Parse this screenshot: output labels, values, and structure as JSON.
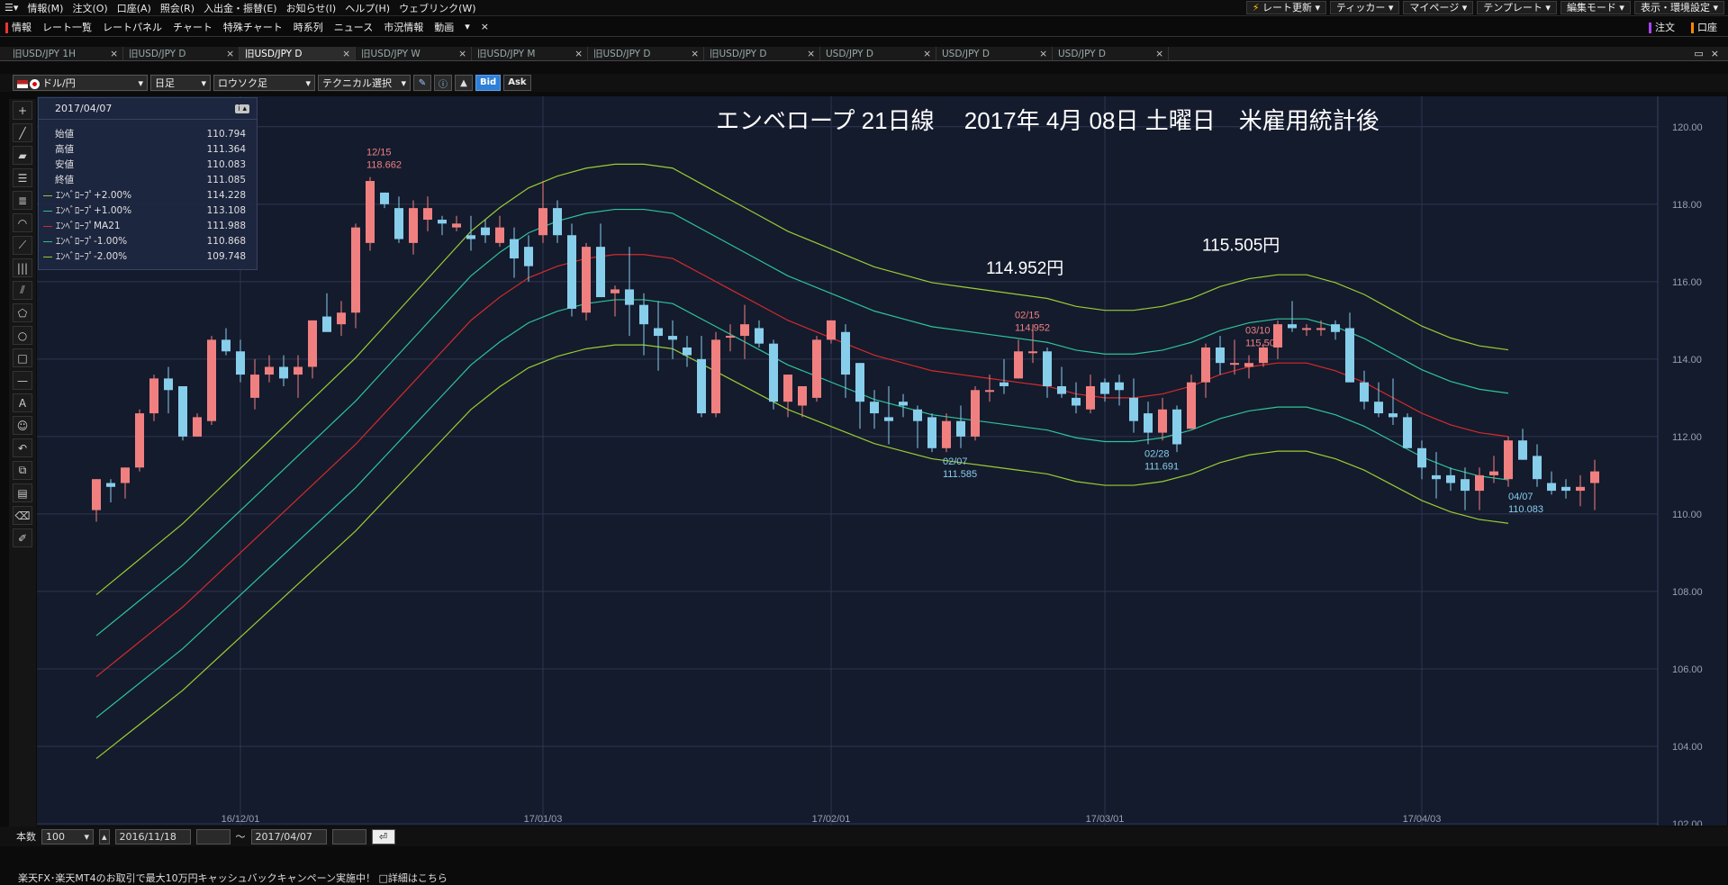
{
  "menu": {
    "items": [
      "情報(M)",
      "注文(O)",
      "口座(A)",
      "照会(R)",
      "入出金・振替(E)",
      "お知らせ(I)",
      "ヘルプ(H)",
      "ウェブリンク(W)"
    ],
    "right_buttons": [
      "レート更新",
      "ティッカー",
      "マイページ",
      "テンプレート",
      "編集モード",
      "表示・環境設定"
    ]
  },
  "nav": {
    "items": [
      "情報",
      "レート一覧",
      "レートパネル",
      "チャート",
      "特殊チャート",
      "時系列",
      "ニュース",
      "市況情報",
      "動画"
    ],
    "right": [
      "注文",
      "口座"
    ]
  },
  "tabs": [
    {
      "label": "旧USD/JPY 1H",
      "active": false
    },
    {
      "label": "旧USD/JPY D",
      "active": false
    },
    {
      "label": "旧USD/JPY D",
      "active": true
    },
    {
      "label": "旧USD/JPY W",
      "active": false
    },
    {
      "label": "旧USD/JPY M",
      "active": false
    },
    {
      "label": "旧USD/JPY D",
      "active": false
    },
    {
      "label": "旧USD/JPY D",
      "active": false
    },
    {
      "label": "USD/JPY D",
      "active": false
    },
    {
      "label": "USD/JPY D",
      "active": false
    },
    {
      "label": "USD/JPY D",
      "active": false
    }
  ],
  "toolbar": {
    "pair": "ドル/円",
    "period": "日足",
    "chart_type": "ロウソク足",
    "technical": "テクニカル選択",
    "bid": "Bid",
    "ask": "Ask"
  },
  "info": {
    "date": "2017/04/07",
    "rows": [
      {
        "label": "始値",
        "value": "110.794"
      },
      {
        "label": "高値",
        "value": "111.364"
      },
      {
        "label": "安値",
        "value": "110.083"
      },
      {
        "label": "終値",
        "value": "111.085"
      }
    ],
    "indicators": [
      {
        "label": "ｴﾝﾍﾞﾛｰﾌﾟ+2.00%",
        "value": "114.228",
        "color": "#9acd32"
      },
      {
        "label": "ｴﾝﾍﾞﾛｰﾌﾟ+1.00%",
        "value": "113.108",
        "color": "#2ec49a"
      },
      {
        "label": "ｴﾝﾍﾞﾛｰﾌﾟMA21",
        "value": "111.988",
        "color": "#d42b2b"
      },
      {
        "label": "ｴﾝﾍﾞﾛｰﾌﾟ-1.00%",
        "value": "110.868",
        "color": "#2ec49a"
      },
      {
        "label": "ｴﾝﾍﾞﾛｰﾌﾟ-2.00%",
        "value": "109.748",
        "color": "#9acd32"
      }
    ]
  },
  "bottom": {
    "count_label": "本数",
    "count": "100",
    "from": "2016/11/18",
    "tilde": "～",
    "to": "2017/04/07"
  },
  "status": "楽天FX･楽天MT4のお取引で最大10万円キャッシュバックキャンペーン実施中！ □詳細はこちら",
  "chart_data": {
    "type": "candlestick",
    "title": "エンベロープ 21日線　 2017年 4月 08日 土曜日　米雇用統計後",
    "ylim": [
      102,
      120.6
    ],
    "yticks": [
      "102.00",
      "104.00",
      "106.00",
      "108.00",
      "110.00",
      "112.00",
      "114.00",
      "116.00",
      "118.00",
      "120.00"
    ],
    "xticks": [
      {
        "i": 10,
        "label": "16/12/01"
      },
      {
        "i": 31,
        "label": "17/01/03"
      },
      {
        "i": 51,
        "label": "17/02/01"
      },
      {
        "i": 70,
        "label": "17/03/01"
      },
      {
        "i": 92,
        "label": "17/04/03"
      }
    ],
    "colors": {
      "up": "#f08080",
      "down": "#87ceeb"
    },
    "candles": [
      [
        110.1,
        110.9,
        109.8,
        110.9
      ],
      [
        110.8,
        110.9,
        110.3,
        110.7
      ],
      [
        110.8,
        111.2,
        110.4,
        111.2
      ],
      [
        111.2,
        112.7,
        111.1,
        112.6
      ],
      [
        112.6,
        113.6,
        112.4,
        113.5
      ],
      [
        113.5,
        113.8,
        112.6,
        113.2
      ],
      [
        113.3,
        113.0,
        111.9,
        112.0
      ],
      [
        112.0,
        112.6,
        112.0,
        112.5
      ],
      [
        112.4,
        114.6,
        112.3,
        114.5
      ],
      [
        114.5,
        114.8,
        114.1,
        114.2
      ],
      [
        114.2,
        114.5,
        113.4,
        113.6
      ],
      [
        113.0,
        114.0,
        112.7,
        113.6
      ],
      [
        113.6,
        114.1,
        113.4,
        113.8
      ],
      [
        113.8,
        114.1,
        113.3,
        113.5
      ],
      [
        113.6,
        114.1,
        113.0,
        113.8
      ],
      [
        113.8,
        114.8,
        113.5,
        115.0
      ],
      [
        115.1,
        115.7,
        114.8,
        114.7
      ],
      [
        114.9,
        115.5,
        114.6,
        115.2
      ],
      [
        115.2,
        117.5,
        114.8,
        117.4
      ],
      [
        117.0,
        118.7,
        116.8,
        118.6
      ],
      [
        118.3,
        118.3,
        117.9,
        118.0
      ],
      [
        117.9,
        118.2,
        117.0,
        117.1
      ],
      [
        117.0,
        118.1,
        116.7,
        117.9
      ],
      [
        117.6,
        118.2,
        117.3,
        117.9
      ],
      [
        117.6,
        117.7,
        117.2,
        117.5
      ],
      [
        117.4,
        117.7,
        117.3,
        117.5
      ],
      [
        117.2,
        117.7,
        116.8,
        117.1
      ],
      [
        117.4,
        117.6,
        117.0,
        117.2
      ],
      [
        117.0,
        117.7,
        116.9,
        117.4
      ],
      [
        117.1,
        117.4,
        116.1,
        116.6
      ],
      [
        116.9,
        117.2,
        116.0,
        116.4
      ],
      [
        117.2,
        118.6,
        117.0,
        117.9
      ],
      [
        117.9,
        118.1,
        117.0,
        117.2
      ],
      [
        117.2,
        117.5,
        115.1,
        115.3
      ],
      [
        115.2,
        117.0,
        115.0,
        116.9
      ],
      [
        116.9,
        117.5,
        115.6,
        115.6
      ],
      [
        115.7,
        115.9,
        115.1,
        115.8
      ],
      [
        115.8,
        116.9,
        114.6,
        115.4
      ],
      [
        115.4,
        115.7,
        114.1,
        114.9
      ],
      [
        114.8,
        115.5,
        113.7,
        114.6
      ],
      [
        114.6,
        115.0,
        114.0,
        114.5
      ],
      [
        114.3,
        114.6,
        113.8,
        114.1
      ],
      [
        114.0,
        114.6,
        112.5,
        112.6
      ],
      [
        112.6,
        114.7,
        112.5,
        114.5
      ],
      [
        114.6,
        114.9,
        114.2,
        114.6
      ],
      [
        114.6,
        115.4,
        114.0,
        114.9
      ],
      [
        114.8,
        115.0,
        114.3,
        114.4
      ],
      [
        114.4,
        114.5,
        112.7,
        112.9
      ],
      [
        112.9,
        113.6,
        112.5,
        113.6
      ],
      [
        112.8,
        113.3,
        112.5,
        113.3
      ],
      [
        113.0,
        114.6,
        112.9,
        114.5
      ],
      [
        114.5,
        115.0,
        114.4,
        115.0
      ],
      [
        114.7,
        114.9,
        113.0,
        113.6
      ],
      [
        113.9,
        113.9,
        112.2,
        112.9
      ],
      [
        112.9,
        113.2,
        112.2,
        112.6
      ],
      [
        112.5,
        113.3,
        111.8,
        112.4
      ],
      [
        112.9,
        113.1,
        112.5,
        112.8
      ],
      [
        112.7,
        112.8,
        111.7,
        112.4
      ],
      [
        112.5,
        112.6,
        111.6,
        111.7
      ],
      [
        111.7,
        112.6,
        111.6,
        112.4
      ],
      [
        112.4,
        112.8,
        111.7,
        112.0
      ],
      [
        112.0,
        113.3,
        111.9,
        113.2
      ],
      [
        113.2,
        113.6,
        112.9,
        113.2
      ],
      [
        113.4,
        114.0,
        113.1,
        113.3
      ],
      [
        113.5,
        114.5,
        113.5,
        114.2
      ],
      [
        114.2,
        114.9,
        113.9,
        114.2
      ],
      [
        114.2,
        114.3,
        113.0,
        113.3
      ],
      [
        113.3,
        113.8,
        113.0,
        113.1
      ],
      [
        113.0,
        113.4,
        112.6,
        112.8
      ],
      [
        112.7,
        113.6,
        112.6,
        113.3
      ],
      [
        113.4,
        113.5,
        112.9,
        113.1
      ],
      [
        113.4,
        113.6,
        112.8,
        113.2
      ],
      [
        113.0,
        113.5,
        112.1,
        112.4
      ],
      [
        112.6,
        112.9,
        111.8,
        112.1
      ],
      [
        112.1,
        113.0,
        111.9,
        112.7
      ],
      [
        112.7,
        112.8,
        111.6,
        111.8
      ],
      [
        112.2,
        113.6,
        112.2,
        113.4
      ],
      [
        113.4,
        114.4,
        113.0,
        114.3
      ],
      [
        114.3,
        114.6,
        113.6,
        113.9
      ],
      [
        113.9,
        114.5,
        113.6,
        113.9
      ],
      [
        113.8,
        114.1,
        113.5,
        113.9
      ],
      [
        113.9,
        114.4,
        113.8,
        114.3
      ],
      [
        114.3,
        115.0,
        114.0,
        114.9
      ],
      [
        114.9,
        115.5,
        114.7,
        114.8
      ],
      [
        114.8,
        114.9,
        114.6,
        114.8
      ],
      [
        114.8,
        115.0,
        114.6,
        114.8
      ],
      [
        114.9,
        115.0,
        114.5,
        114.7
      ],
      [
        114.8,
        115.2,
        113.4,
        113.4
      ],
      [
        113.4,
        113.7,
        112.7,
        112.9
      ],
      [
        112.9,
        113.4,
        112.5,
        112.6
      ],
      [
        112.6,
        113.5,
        112.3,
        112.5
      ],
      [
        112.5,
        112.6,
        111.7,
        111.7
      ],
      [
        111.7,
        111.9,
        110.9,
        111.2
      ],
      [
        111.0,
        111.6,
        110.4,
        110.9
      ],
      [
        111.0,
        111.2,
        110.6,
        110.8
      ],
      [
        110.9,
        111.2,
        110.1,
        110.6
      ],
      [
        110.6,
        111.2,
        110.1,
        111.0
      ],
      [
        111.0,
        111.5,
        110.8,
        111.1
      ],
      [
        110.9,
        112.0,
        110.7,
        111.9
      ],
      [
        111.9,
        112.2,
        111.4,
        111.4
      ],
      [
        111.5,
        111.8,
        110.7,
        110.9
      ],
      [
        110.8,
        111.1,
        110.5,
        110.6
      ],
      [
        110.7,
        110.9,
        110.4,
        110.6
      ],
      [
        110.6,
        111.0,
        110.2,
        110.7
      ],
      [
        110.8,
        111.4,
        110.1,
        111.1
      ]
    ],
    "envelope": {
      "ma21": [
        [
          0,
          105.8
        ],
        [
          2,
          106.4
        ],
        [
          4,
          107.0
        ],
        [
          6,
          107.6
        ],
        [
          8,
          108.3
        ],
        [
          10,
          109.0
        ],
        [
          12,
          109.7
        ],
        [
          14,
          110.4
        ],
        [
          16,
          111.1
        ],
        [
          18,
          111.8
        ],
        [
          20,
          112.6
        ],
        [
          22,
          113.4
        ],
        [
          24,
          114.2
        ],
        [
          26,
          115.0
        ],
        [
          28,
          115.6
        ],
        [
          30,
          116.1
        ],
        [
          32,
          116.4
        ],
        [
          34,
          116.6
        ],
        [
          36,
          116.7
        ],
        [
          38,
          116.7
        ],
        [
          40,
          116.6
        ],
        [
          42,
          116.2
        ],
        [
          44,
          115.8
        ],
        [
          46,
          115.4
        ],
        [
          48,
          115.0
        ],
        [
          50,
          114.7
        ],
        [
          52,
          114.4
        ],
        [
          54,
          114.1
        ],
        [
          56,
          113.9
        ],
        [
          58,
          113.7
        ],
        [
          60,
          113.6
        ],
        [
          62,
          113.5
        ],
        [
          64,
          113.4
        ],
        [
          66,
          113.3
        ],
        [
          68,
          113.1
        ],
        [
          70,
          113.0
        ],
        [
          72,
          113.0
        ],
        [
          74,
          113.1
        ],
        [
          76,
          113.3
        ],
        [
          78,
          113.6
        ],
        [
          80,
          113.8
        ],
        [
          82,
          113.9
        ],
        [
          84,
          113.9
        ],
        [
          86,
          113.7
        ],
        [
          88,
          113.4
        ],
        [
          90,
          113.0
        ],
        [
          92,
          112.6
        ],
        [
          94,
          112.3
        ],
        [
          96,
          112.1
        ],
        [
          98,
          112.0
        ]
      ],
      "labels": [
        "+2.00%",
        "+1.00%",
        "MA21",
        "-1.00%",
        "-2.00%"
      ],
      "pct": [
        0.02,
        0.01,
        0,
        -0.01,
        -0.02
      ],
      "colors": [
        "#9acd32",
        "#2ec49a",
        "#d42b2b",
        "#2ec49a",
        "#9acd32"
      ]
    },
    "annotations": [
      {
        "i": 19,
        "date": "12/15",
        "value": "118.662",
        "pos": "above",
        "color": "#f08080"
      },
      {
        "i": 59,
        "date": "02/07",
        "value": "111.585",
        "pos": "below",
        "color": "#87ceeb"
      },
      {
        "i": 64,
        "date": "02/15",
        "value": "114.952",
        "pos": "above",
        "color": "#f08080"
      },
      {
        "i": 73,
        "date": "02/28",
        "value": "111.691",
        "pos": "below",
        "color": "#87ceeb"
      },
      {
        "i": 80,
        "date": "03/10",
        "value": "115.505",
        "pos": "above",
        "color": "#f08080"
      },
      {
        "i": 98,
        "date": "04/07",
        "value": "110.083",
        "pos": "below",
        "color": "#87ceeb"
      }
    ],
    "big_labels": [
      {
        "i": 63,
        "price": 116.2,
        "text": "114.952円"
      },
      {
        "i": 78,
        "price": 116.8,
        "text": "115.505円"
      }
    ]
  }
}
